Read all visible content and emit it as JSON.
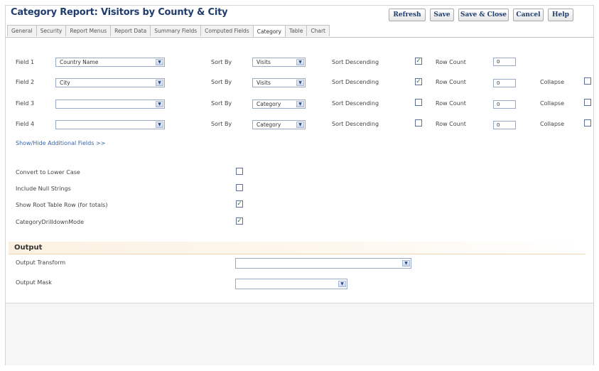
{
  "title": "Category Report: Visitors by County & City",
  "buttons": {
    "refresh": "Refresh",
    "save": "Save",
    "save_close": "Save & Close",
    "cancel": "Cancel",
    "help": "Help"
  },
  "tabs": [
    {
      "label": "General"
    },
    {
      "label": "Security"
    },
    {
      "label": "Report Menus"
    },
    {
      "label": "Report Data"
    },
    {
      "label": "Summary Fields"
    },
    {
      "label": "Computed Fields"
    },
    {
      "label": "Category",
      "active": true
    },
    {
      "label": "Table"
    },
    {
      "label": "Chart"
    }
  ],
  "fields": [
    {
      "label": "Field 1",
      "value": "Country Name",
      "sort_by_label": "Sort By",
      "sort_by": "Visits",
      "sort_desc_label": "Sort Descending",
      "sort_desc": true,
      "row_count_label": "Row Count",
      "row_count": "0",
      "collapse_label": "",
      "collapse": null
    },
    {
      "label": "Field 2",
      "value": "City",
      "sort_by_label": "Sort By",
      "sort_by": "Visits",
      "sort_desc_label": "Sort Descending",
      "sort_desc": true,
      "row_count_label": "Row Count",
      "row_count": "0",
      "collapse_label": "Collapse",
      "collapse": false
    },
    {
      "label": "Field 3",
      "value": "",
      "sort_by_label": "Sort By",
      "sort_by": "Category",
      "sort_desc_label": "Sort Descending",
      "sort_desc": false,
      "row_count_label": "Row Count",
      "row_count": "0",
      "collapse_label": "Collapse",
      "collapse": false
    },
    {
      "label": "Field 4",
      "value": "",
      "sort_by_label": "Sort By",
      "sort_by": "Category",
      "sort_desc_label": "Sort Descending",
      "sort_desc": false,
      "row_count_label": "Row Count",
      "row_count": "0",
      "collapse_label": "Collapse",
      "collapse": false
    }
  ],
  "show_hide_link": "Show/Hide Additional Fields >>",
  "options": [
    {
      "label": "Convert to Lower Case",
      "checked": false
    },
    {
      "label": "Include Null Strings",
      "checked": false
    },
    {
      "label": "Show Root Table Row (for totals)",
      "checked": true
    },
    {
      "label": "CategoryDrilldownMode",
      "checked": true
    }
  ],
  "output": {
    "heading": "Output",
    "transform_label": "Output Transform",
    "transform_value": "",
    "mask_label": "Output Mask",
    "mask_value": ""
  },
  "icons": {
    "dropdown": "chevron-down-icon",
    "checkbox_checked": "checkmark-icon"
  }
}
